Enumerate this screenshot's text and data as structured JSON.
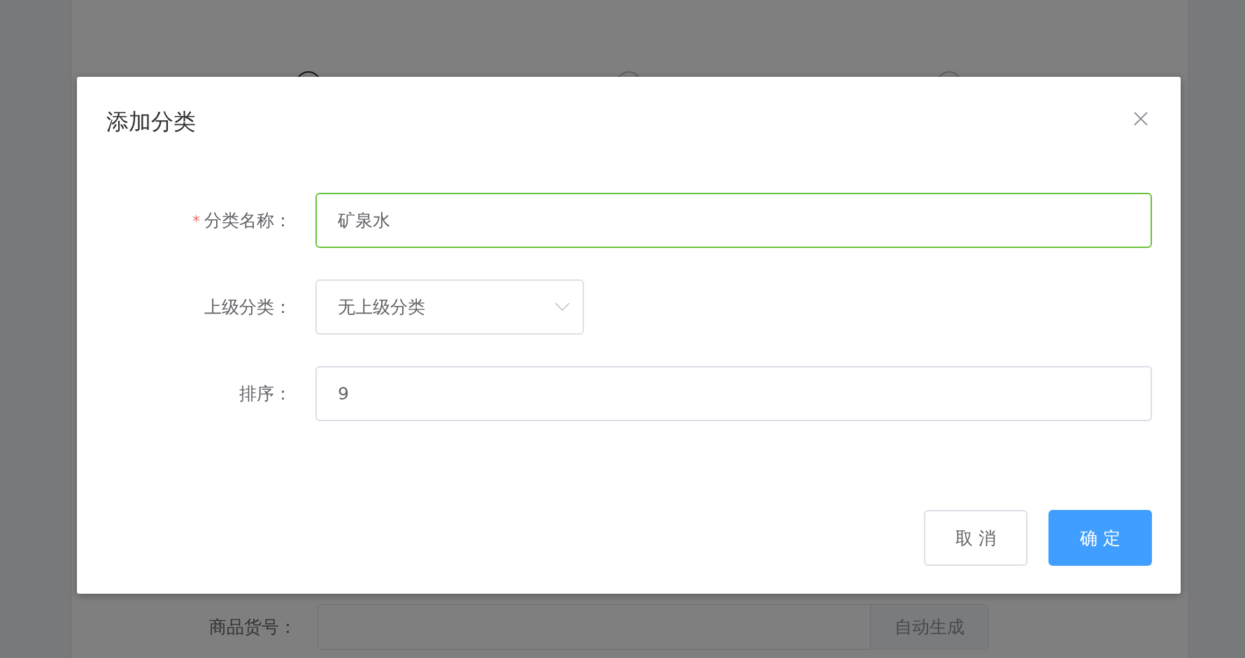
{
  "background_page": {
    "steps": [
      {
        "selected": true
      },
      {
        "selected": false
      },
      {
        "selected": false
      }
    ],
    "form_row": {
      "label": "商品货号：",
      "addon_button": "自动生成"
    }
  },
  "dialog": {
    "title": "添加分类",
    "fields": [
      {
        "kind": "input",
        "required_mark": "*",
        "label": "分类名称：",
        "value": "矿泉水",
        "valid": true
      },
      {
        "kind": "select",
        "label": "上级分类：",
        "value": "无上级分类",
        "valid": false
      },
      {
        "kind": "input",
        "label": "排序：",
        "value": "9",
        "valid": false
      }
    ],
    "buttons": [
      {
        "label": "取 消",
        "kind": "default"
      },
      {
        "label": "确 定",
        "kind": "primary"
      }
    ]
  }
}
